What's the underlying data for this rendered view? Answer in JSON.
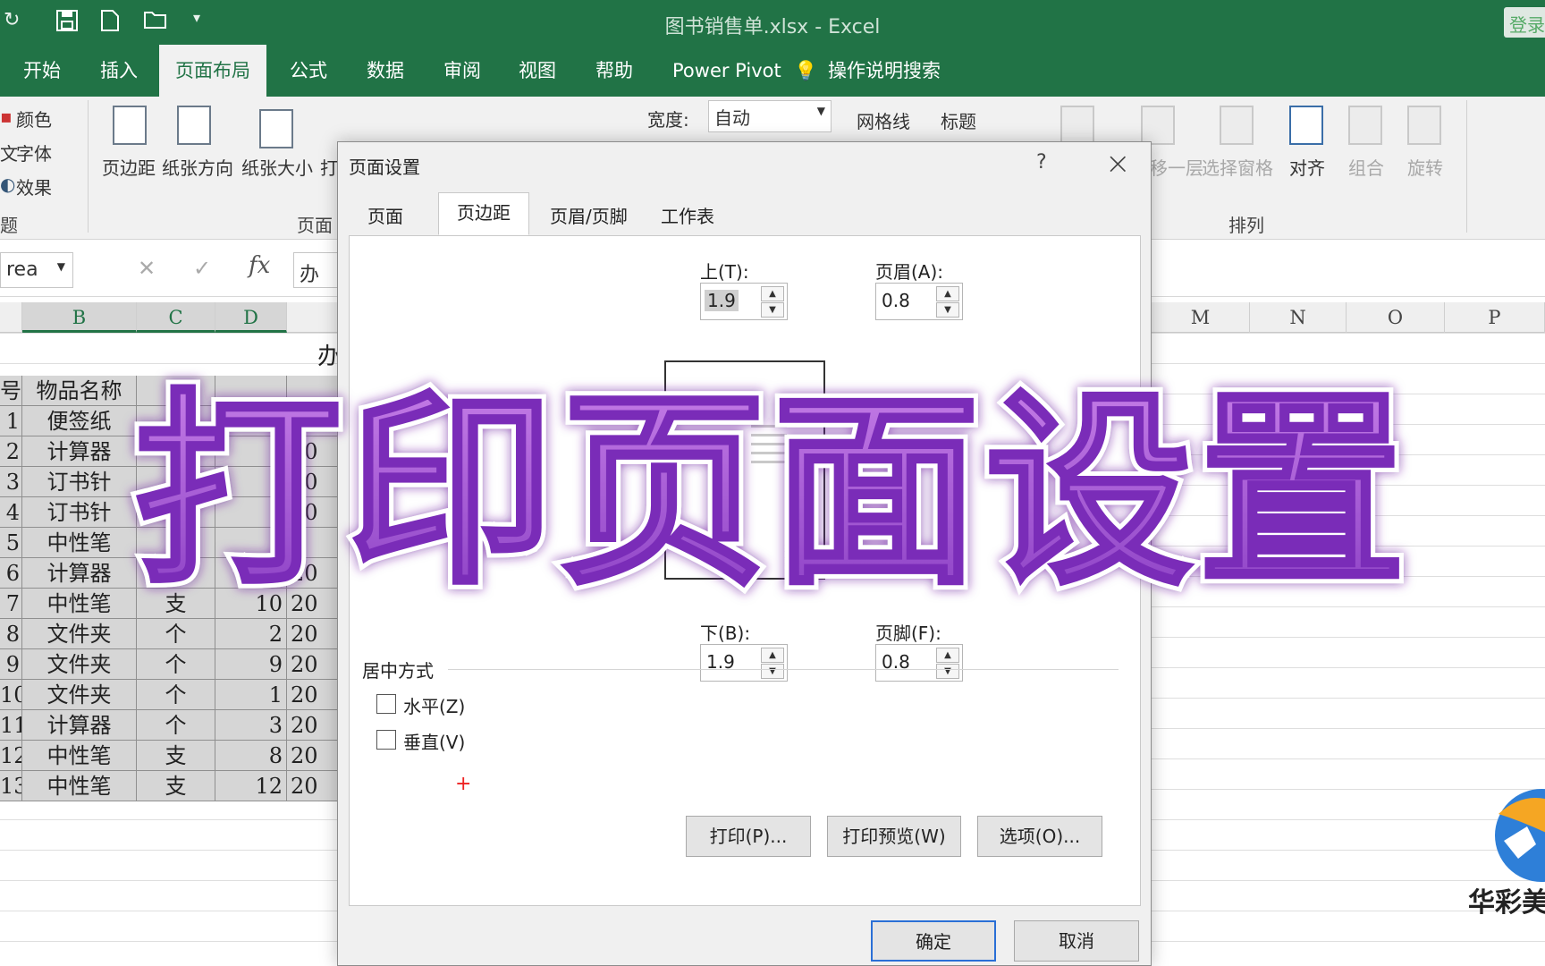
{
  "window": {
    "title": "图书销售单.xlsx  -  Excel",
    "login_label": "登录"
  },
  "tabs": [
    "开始",
    "插入",
    "页面布局",
    "公式",
    "数据",
    "审阅",
    "视图",
    "帮助",
    "Power Pivot",
    "操作说明搜索"
  ],
  "ribbon": {
    "theme_colors": "颜色",
    "theme_fonts": "字体",
    "theme_effects": "效果",
    "theme_group": "题",
    "margins": "页边距",
    "orientation": "纸张方向",
    "size": "纸张大小",
    "print_area": "打",
    "page_setup_group": "页面",
    "width_label": "宽度:",
    "width_value": "自动",
    "gridlines": "网格线",
    "headings": "标题",
    "send_backward": "移一层",
    "selection_pane": "选择窗格",
    "align": "对齐",
    "group": "组合",
    "rotate": "旋转",
    "arrange_group": "排列"
  },
  "formula_bar": {
    "name_box": "rea",
    "content": "办"
  },
  "columns": {
    "left": [
      "B",
      "C",
      "D"
    ],
    "right": [
      "M",
      "N",
      "O",
      "P"
    ]
  },
  "sheet": {
    "title_partial": "办",
    "header": {
      "no": "号",
      "name": "物品名称"
    },
    "rows": [
      {
        "no": "1",
        "name": "便签纸",
        "unit": "",
        "qty": "",
        "date": ""
      },
      {
        "no": "2",
        "name": "计算器",
        "unit": "",
        "qty": "",
        "date": "20"
      },
      {
        "no": "3",
        "name": "订书针",
        "unit": "",
        "qty": "",
        "date": "20"
      },
      {
        "no": "4",
        "name": "订书针",
        "unit": "",
        "qty": "",
        "date": "20"
      },
      {
        "no": "5",
        "name": "中性笔",
        "unit": "",
        "qty": "",
        "date": "2"
      },
      {
        "no": "6",
        "name": "计算器",
        "unit": "",
        "qty": "",
        "date": "20"
      },
      {
        "no": "7",
        "name": "中性笔",
        "unit": "支",
        "qty": "10",
        "date": "20"
      },
      {
        "no": "8",
        "name": "文件夹",
        "unit": "个",
        "qty": "2",
        "date": "20"
      },
      {
        "no": "9",
        "name": "文件夹",
        "unit": "个",
        "qty": "9",
        "date": "20"
      },
      {
        "no": "10",
        "name": "文件夹",
        "unit": "个",
        "qty": "1",
        "date": "20"
      },
      {
        "no": "11",
        "name": "计算器",
        "unit": "个",
        "qty": "3",
        "date": "20"
      },
      {
        "no": "12",
        "name": "中性笔",
        "unit": "支",
        "qty": "8",
        "date": "20"
      },
      {
        "no": "13",
        "name": "中性笔",
        "unit": "支",
        "qty": "12",
        "date": "20"
      }
    ]
  },
  "dialog": {
    "title": "页面设置",
    "help": "?",
    "tabs": [
      "页面",
      "页边距",
      "页眉/页脚",
      "工作表"
    ],
    "top_label": "上(T):",
    "top_value": "1.9",
    "header_label": "页眉(A):",
    "header_value": "0.8",
    "left_partial": "):",
    "bottom_label": "下(B):",
    "bottom_value": "1.9",
    "footer_label": "页脚(F):",
    "footer_value": "0.8",
    "center_section": "居中方式",
    "horizontal": "水平(Z)",
    "vertical": "垂直(V)",
    "print_btn": "打印(P)...",
    "preview_btn": "打印预览(W)",
    "options_btn": "选项(O)...",
    "ok_btn": "确定",
    "cancel_btn": "取消"
  },
  "overlay_caption": "打印页面设置",
  "watermark": "华彩美",
  "colors": {
    "excel_green": "#217346",
    "overlay_purple": "#8a3fc4"
  }
}
